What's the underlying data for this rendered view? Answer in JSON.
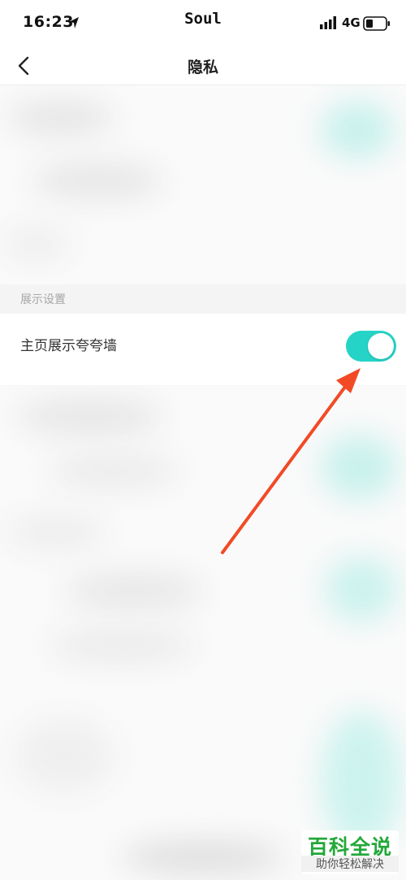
{
  "status_bar": {
    "time": "16:23",
    "app_name": "Soul",
    "network": "4G"
  },
  "nav": {
    "title": "隐私"
  },
  "section": {
    "label": "展示设置"
  },
  "setting": {
    "label": "主页展示夸夸墙",
    "enabled": true
  },
  "colors": {
    "accent": "#25d4c6",
    "annotation_arrow": "#f24a26"
  },
  "watermark": {
    "title": "百科全说",
    "subtitle": "助你轻松解决"
  }
}
